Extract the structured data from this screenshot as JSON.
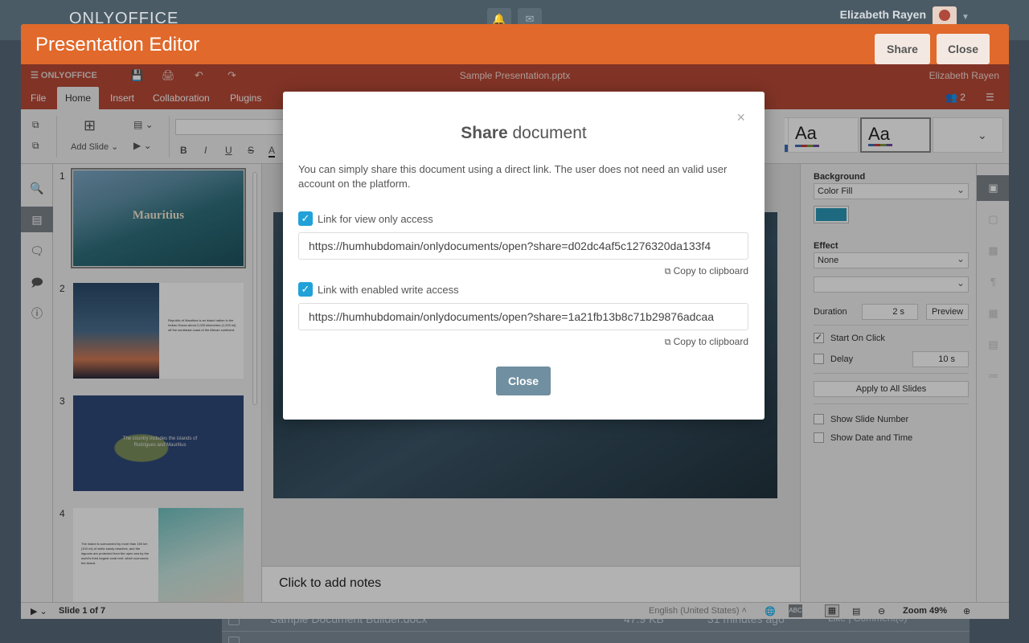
{
  "background": {
    "logo": "ONLYOFFICE",
    "user_name": "Elizabeth Rayen",
    "rows": [
      {
        "name": "Sample Document Builder.docx",
        "size": "47.9 KB",
        "time": "31 minutes ago",
        "actions": "Like | Comment(0)"
      },
      {
        "name": "",
        "size": "",
        "time": "",
        "actions": ""
      }
    ]
  },
  "window": {
    "title": "Presentation Editor",
    "share_label": "Share",
    "close_label": "Close"
  },
  "editor": {
    "logo": "ONLYOFFICE",
    "doc_name": "Sample Presentation.pptx",
    "user_name": "Elizabeth Rayen",
    "users_count": "2",
    "tabs": [
      "File",
      "Home",
      "Insert",
      "Collaboration",
      "Plugins"
    ],
    "active_tab": "Home",
    "add_slide_label": "Add Slide",
    "notes_placeholder": "Click to add notes",
    "thumbnails": [
      {
        "num": "1",
        "title": "Mauritius",
        "text": ""
      },
      {
        "num": "2",
        "title": "",
        "text": "Republic of Mauritius is an island nation in the Indian Ocean about 2,000 kilometres (1,200 mi) off the southeast coast of the African continent."
      },
      {
        "num": "3",
        "title": "",
        "text": "The country includes the islands of Rodrigues and Mauritius"
      },
      {
        "num": "4",
        "title": "",
        "text": "The island is surrounded by more than 150 km (100 mi) of white sandy beaches, and the lagoons are protected from the open sea by the world's third largest coral reef, which surrounds the island."
      }
    ],
    "right_panel": {
      "background_label": "Background",
      "background_value": "Color Fill",
      "color": "#2a99b8",
      "effect_label": "Effect",
      "effect_value": "None",
      "effect_type_value": "",
      "duration_label": "Duration",
      "duration_value": "2 s",
      "preview_label": "Preview",
      "start_on_click_label": "Start On Click",
      "start_on_click_checked": true,
      "delay_label": "Delay",
      "delay_value": "10 s",
      "apply_all_label": "Apply to All Slides",
      "show_slide_number_label": "Show Slide Number",
      "show_date_time_label": "Show Date and Time"
    },
    "status": {
      "slide_info": "Slide 1 of 7",
      "language": "English (United States)",
      "zoom": "Zoom 49%"
    }
  },
  "modal": {
    "title_bold": "Share",
    "title_rest": "document",
    "description": "You can simply share this document using a direct link. The user does not need an valid user account on the platform.",
    "view_label": "Link for view only access",
    "view_checked": true,
    "view_url": "https://humhubdomain/onlydocuments/open?share=d02dc4af5c1276320da133f4",
    "write_label": "Link with enabled write access",
    "write_checked": true,
    "write_url": "https://humhubdomain/onlydocuments/open?share=1a21fb13b8c71b29876adcaa",
    "copy_label": "Copy to clipboard",
    "close_label": "Close"
  },
  "colors": {
    "window_header": "#e0692b",
    "editor_bar": "#b94a37",
    "checkbox": "#21a1d8",
    "close_button": "#708fa0"
  }
}
